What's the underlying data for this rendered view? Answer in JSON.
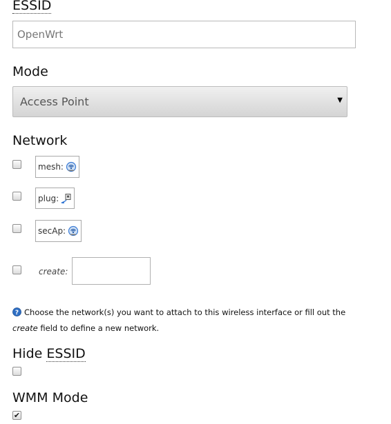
{
  "essid": {
    "label": "ESSID",
    "value": "OpenWrt"
  },
  "mode": {
    "label": "Mode",
    "selected": "Access Point",
    "arrow_glyph": "▼"
  },
  "network": {
    "label": "Network",
    "items": [
      {
        "name": "mesh:",
        "icon": "wireless-network-icon",
        "checked": false
      },
      {
        "name": "plug:",
        "icon": "ethernet-plug-icon",
        "checked": false
      },
      {
        "name": "secAp:",
        "icon": "wireless-network-icon",
        "checked": false
      }
    ],
    "create_label": "create:",
    "create_value": "",
    "create_checked": false,
    "help_prefix": "Choose the network(s) you want to attach to this wireless interface or fill out the",
    "help_emphasis": "create",
    "help_suffix": "field to define a new network."
  },
  "hide_essid": {
    "label_prefix": "Hide",
    "label_abbr": "ESSID",
    "checked": false
  },
  "wmm_mode": {
    "label": "WMM Mode",
    "checked": true,
    "check_glyph": "✔"
  },
  "colors": {
    "help_icon": "#2f6fc4",
    "wireless_icon": "#3a7bd5"
  }
}
